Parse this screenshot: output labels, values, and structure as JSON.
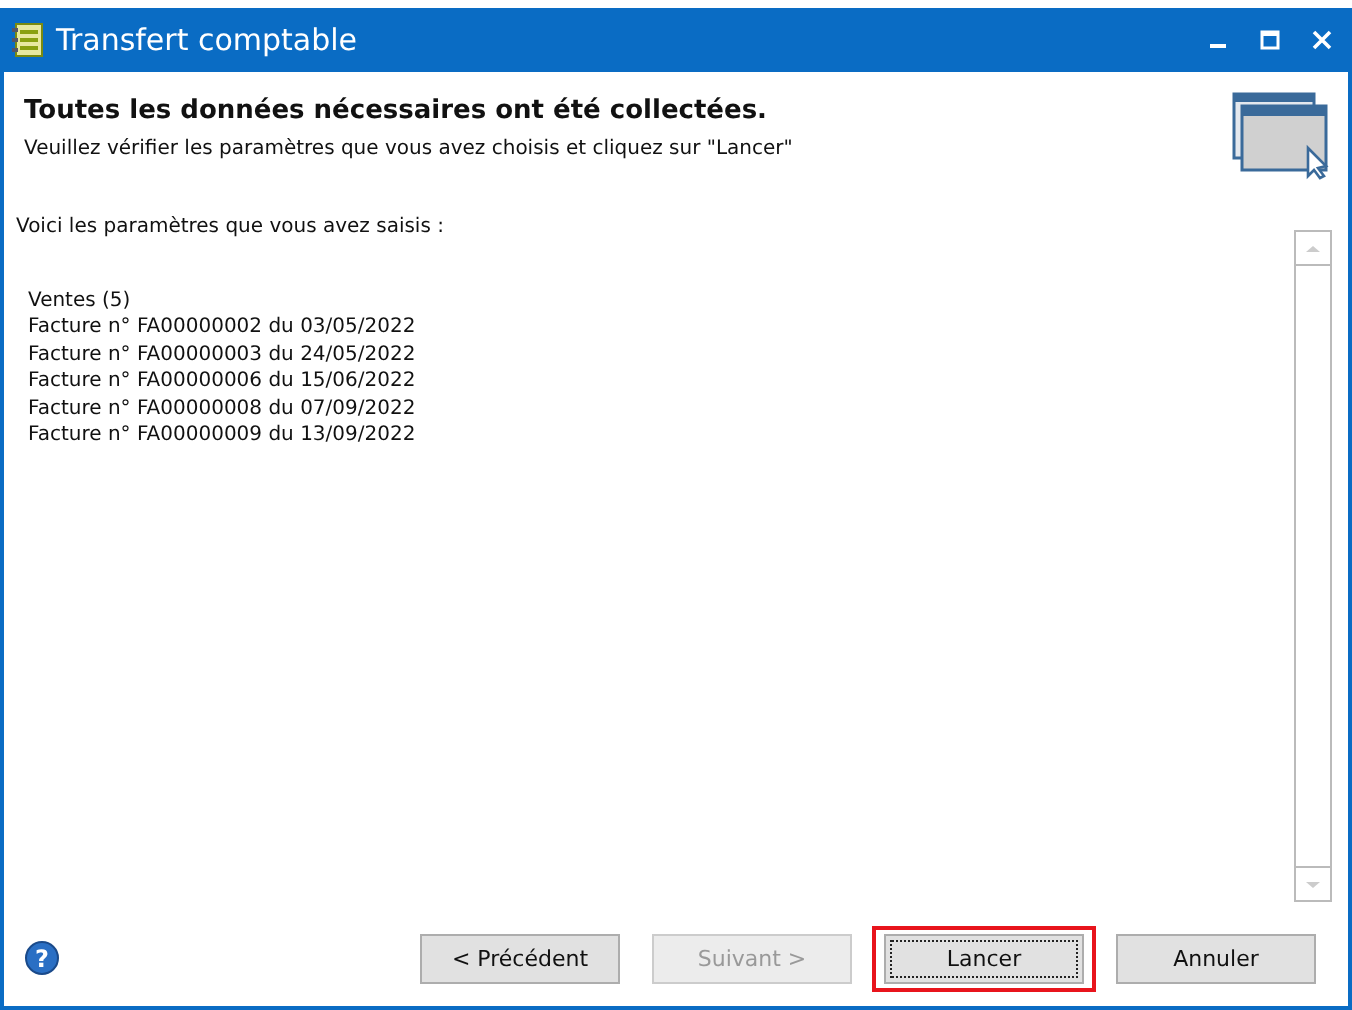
{
  "window": {
    "title": "Transfert comptable"
  },
  "header": {
    "title": "Toutes les données nécessaires ont été collectées.",
    "subtitle": "Veuillez vérifier les paramètres que vous avez choisis et cliquez sur \"Lancer\""
  },
  "intro": "Voici les paramètres que vous avez saisis :",
  "summary": [
    "Ventes (5)",
    "Facture n° FA00000002 du 03/05/2022",
    "Facture n° FA00000003 du 24/05/2022",
    "Facture n° FA00000006 du 15/06/2022",
    "Facture n° FA00000008 du 07/09/2022",
    "Facture n° FA00000009 du 13/09/2022"
  ],
  "help": "?",
  "buttons": [
    {
      "label": "< Précédent",
      "disabled": false,
      "focused": false,
      "highlighted": false
    },
    {
      "label": "Suivant >",
      "disabled": true,
      "focused": false,
      "highlighted": false
    },
    {
      "label": "Lancer",
      "disabled": false,
      "focused": true,
      "highlighted": true
    },
    {
      "label": "Annuler",
      "disabled": false,
      "focused": false,
      "highlighted": false
    }
  ]
}
